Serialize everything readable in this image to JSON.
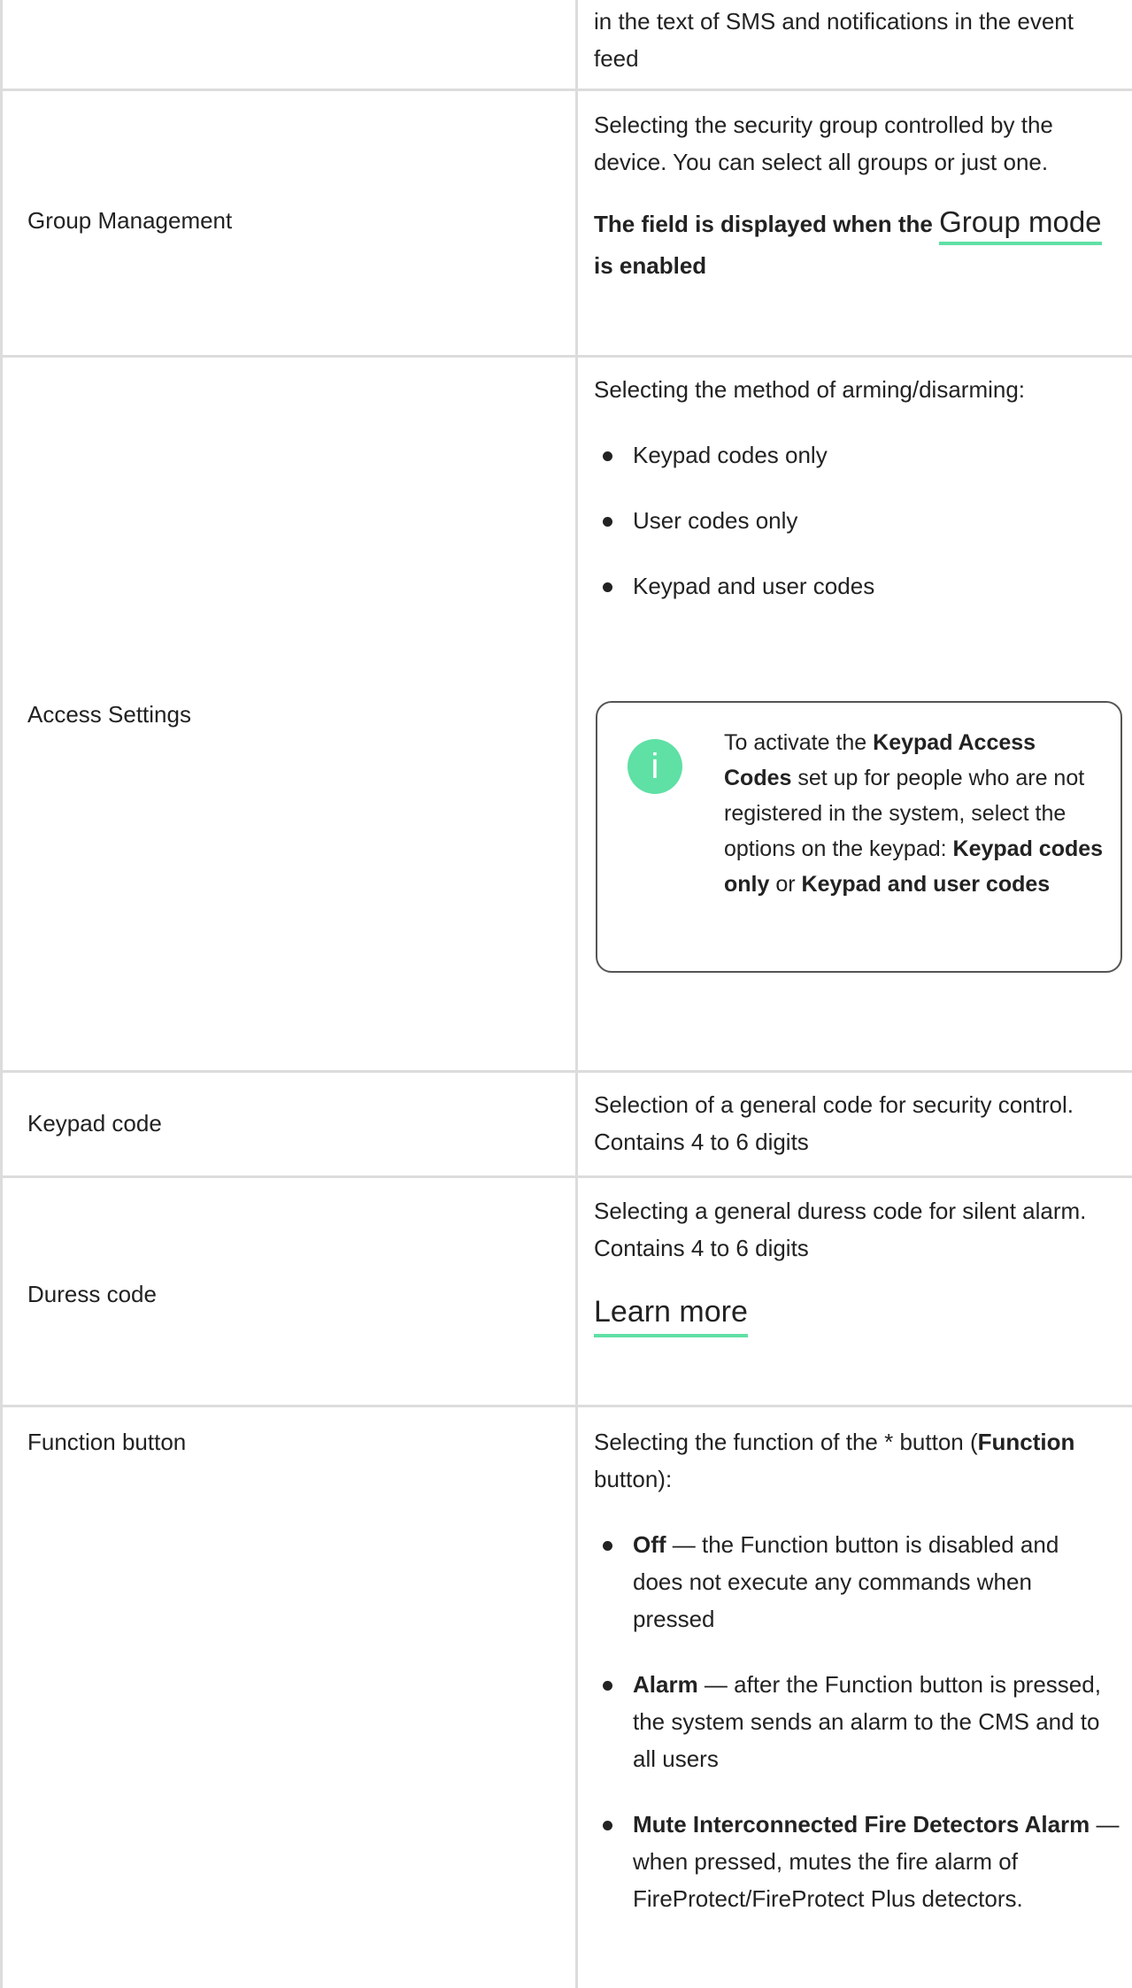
{
  "rows": [
    {
      "right_lines": [
        "in the text of SMS and notifications in the event",
        "feed"
      ]
    },
    {
      "label": "Group Management",
      "desc": "Selecting the security group controlled by the device. You can select all groups or just one.",
      "note_prefix": "The field is displayed when the",
      "note_link": "Group mode",
      "note_suffix": "is enabled"
    },
    {
      "label": "Access Settings",
      "desc": "Selecting the method of arming/disarming:",
      "options": [
        "Keypad codes only",
        "User codes only",
        "Keypad and user codes"
      ],
      "info": {
        "t1": "To activate the ",
        "b1": "Keypad Access Codes",
        "t2": " set up for people who are not registered in the system, select the options on the keypad: ",
        "b2": "Keypad codes only",
        "t3": " or ",
        "b3": "Keypad and user codes"
      }
    },
    {
      "label": "Keypad code",
      "desc": "Selection of a general code for security control. Contains 4 to 6 digits"
    },
    {
      "label": "Duress code",
      "desc": "Selecting a general duress code for silent alarm. Contains 4 to 6 digits",
      "link": "Learn more"
    },
    {
      "label": "Function button",
      "desc_prefix": "Selecting the function of the * button (",
      "desc_bold": "Function",
      "desc_suffix": " button):",
      "items": [
        {
          "bold": "Off",
          "text": " — the Function button is disabled and does not execute any commands when pressed"
        },
        {
          "bold": "Alarm",
          "text": " — after the Function button is pressed, the system sends an alarm to the CMS and to all users"
        },
        {
          "bold": "Mute Interconnected Fire Detectors Alarm",
          "text": " — when pressed, mutes the fire alarm of FireProtect/FireProtect Plus detectors."
        }
      ]
    }
  ],
  "colors": {
    "accent": "#5fe0a5",
    "border": "#dcdcdc",
    "text": "#222222"
  },
  "icons": {
    "info": "info-icon"
  }
}
